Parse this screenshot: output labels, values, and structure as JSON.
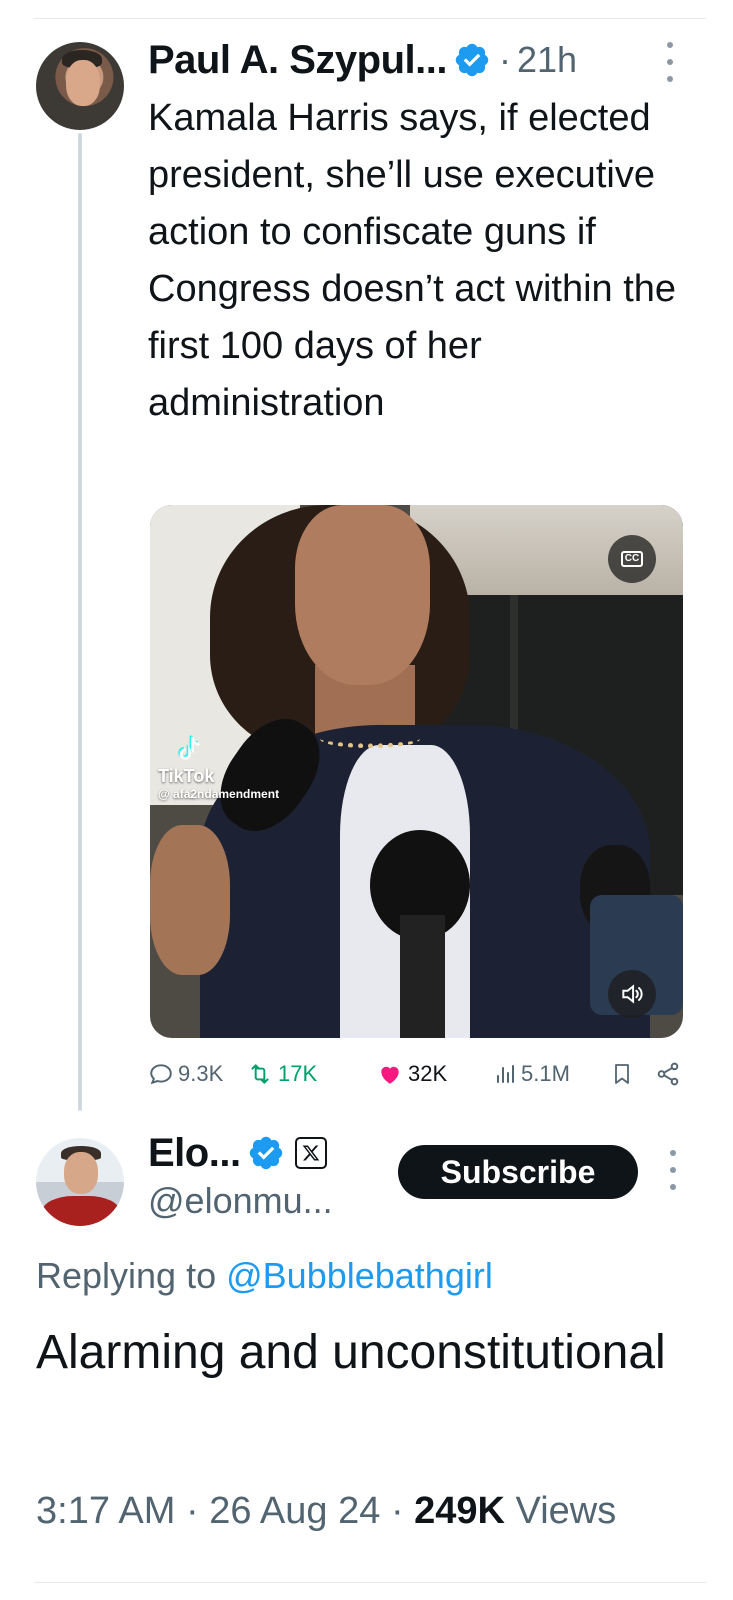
{
  "original_tweet": {
    "author_name": "Paul A. Szypul...",
    "verified": true,
    "separator": "·",
    "time_ago": "21h",
    "text": "Kamala Harris says, if elected president, she’ll use executive action to confiscate guns if Congress doesn’t act within the first 100 days of her administration",
    "media": {
      "cc_label": "CC",
      "watermark_brand": "TikTok",
      "watermark_handle": "@ afa2ndamendment"
    },
    "stats": {
      "replies": "9.3K",
      "retweets": "17K",
      "likes": "32K",
      "views": "5.1M"
    }
  },
  "reply_tweet": {
    "author_name": "Elo...",
    "verified": true,
    "affiliate_badge": "X",
    "handle": "@elonmu...",
    "subscribe_label": "Subscribe",
    "replying_to_label": "Replying to ",
    "replying_to_handle": "@Bubblebathgirl",
    "text": "Alarming and unconstitutional",
    "time": "3:17 AM",
    "date": "26 Aug 24",
    "separator": "·",
    "views_count": "249K",
    "views_label": " Views"
  },
  "colors": {
    "verified_blue": "#1d9bf0",
    "retweet_green": "#00a06a",
    "like_pink": "#f91880",
    "secondary_text": "#536471"
  }
}
